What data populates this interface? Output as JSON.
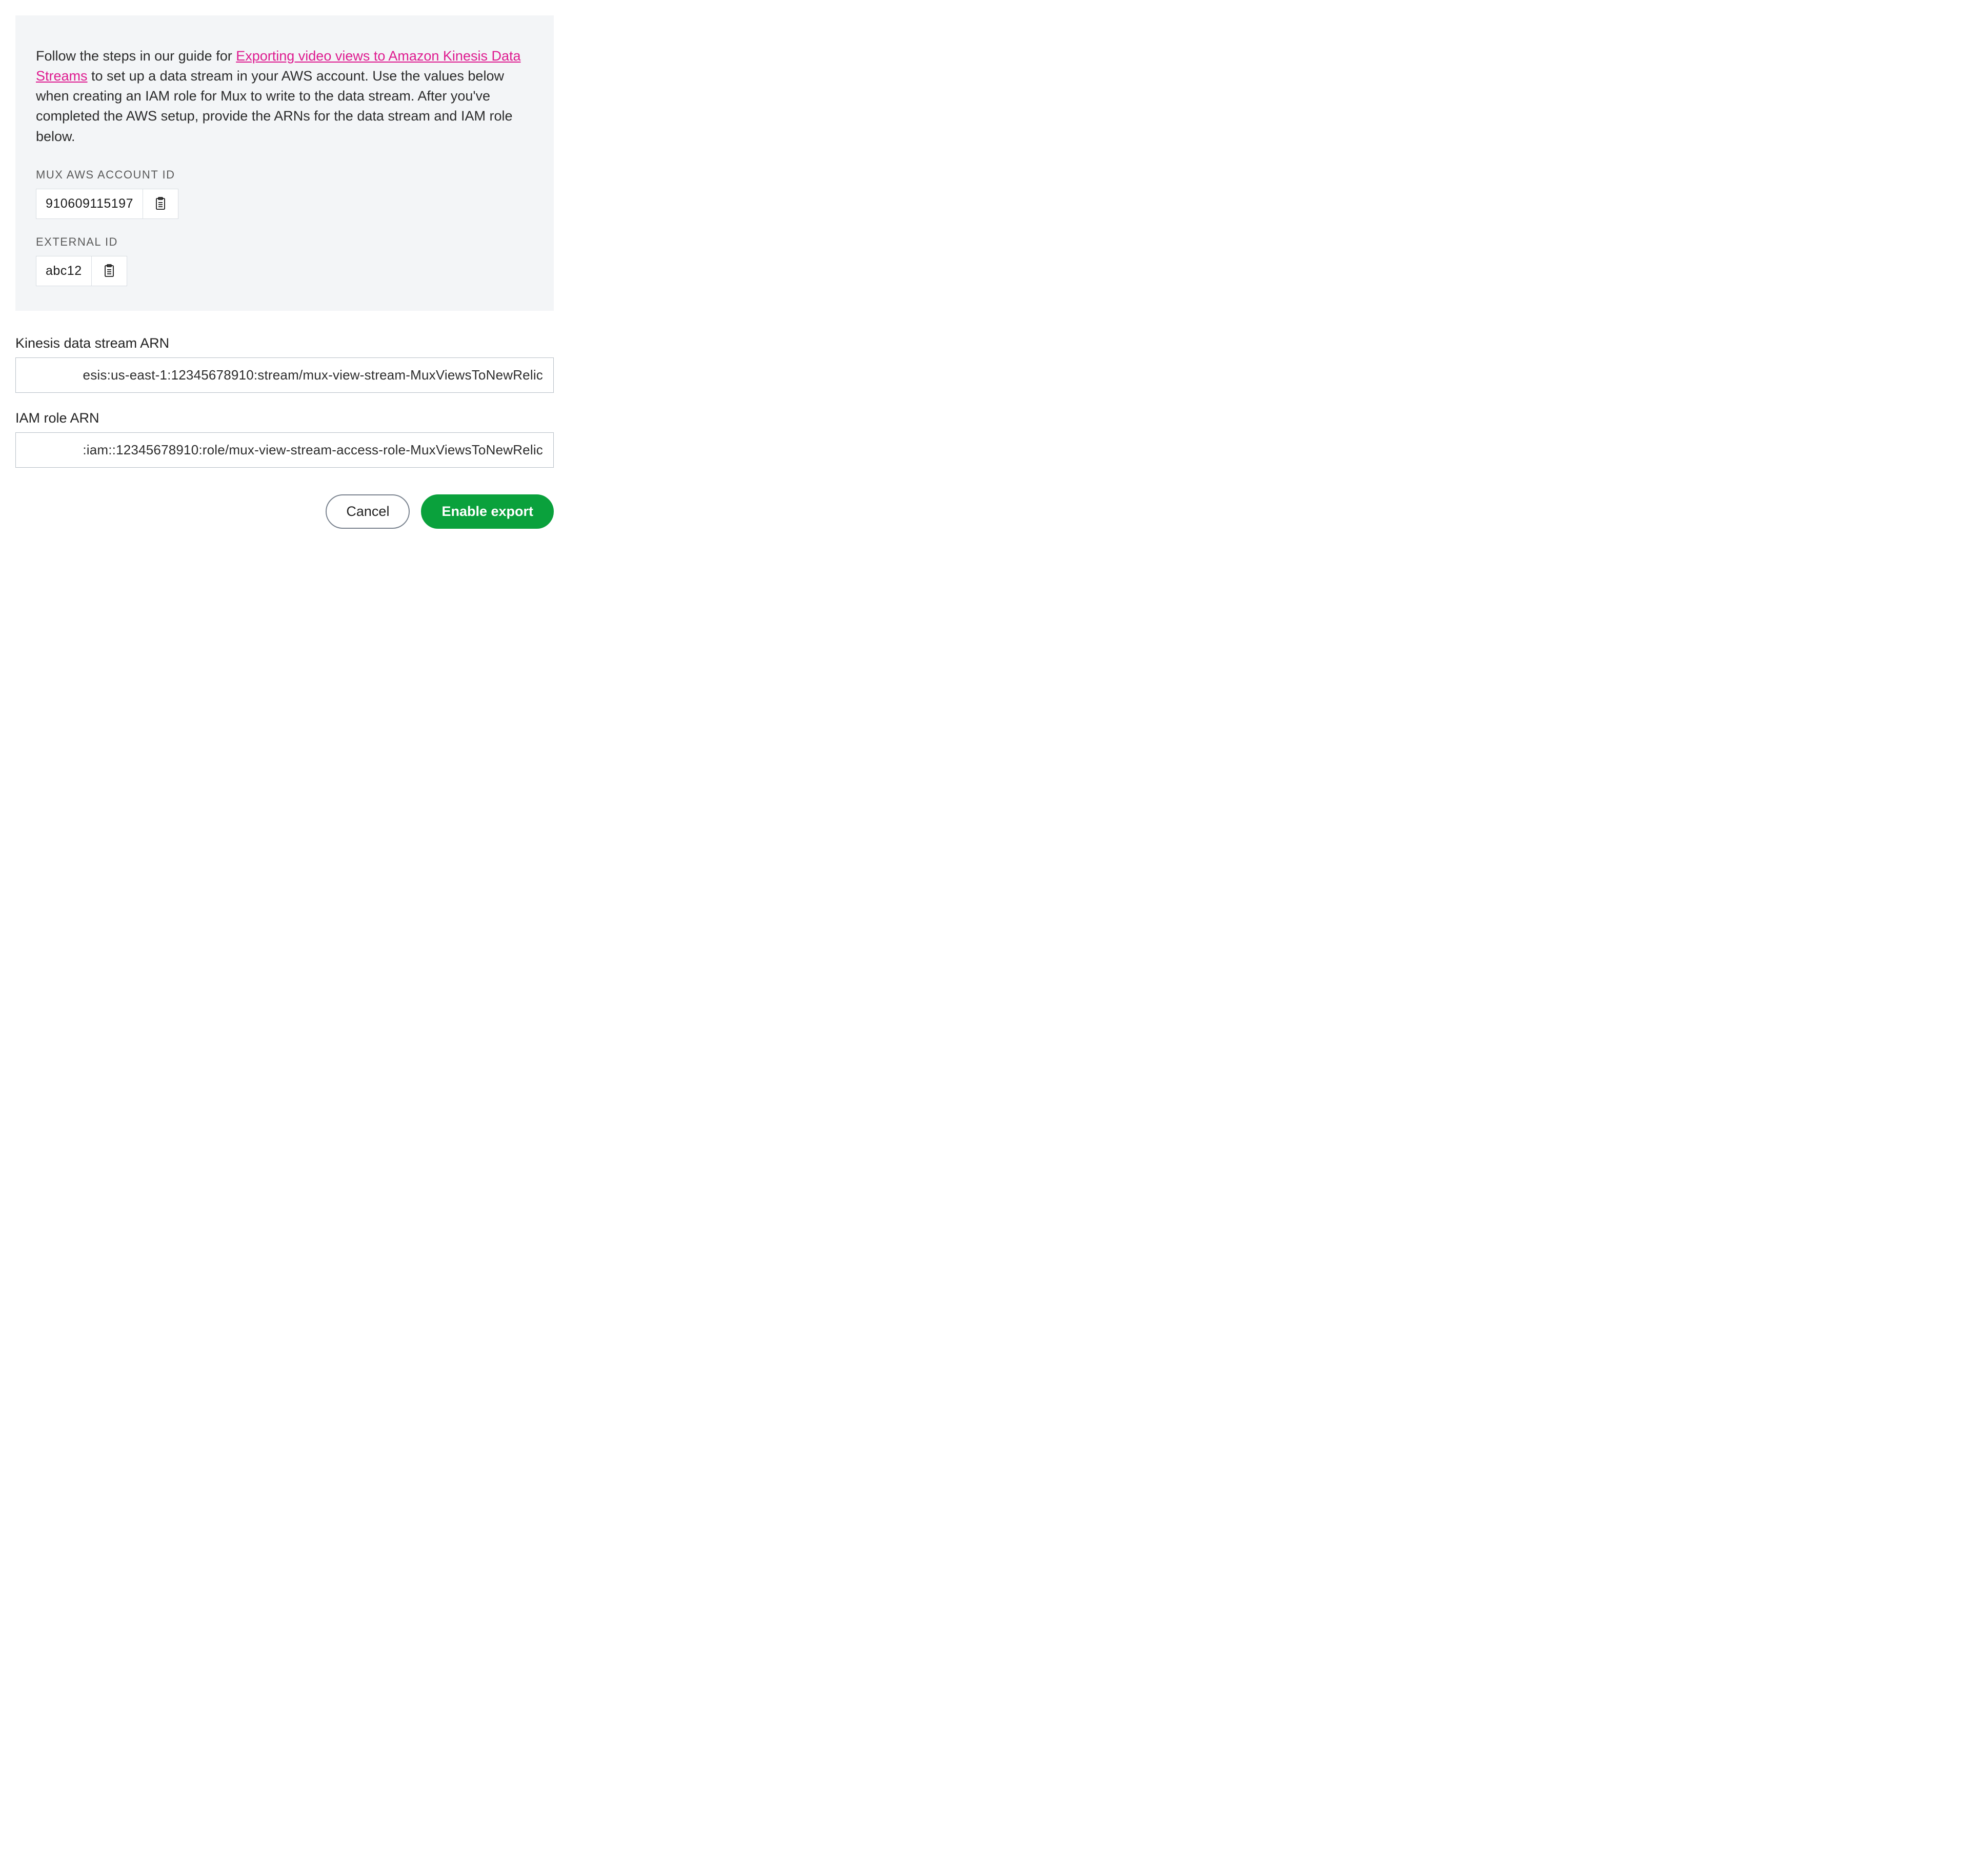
{
  "info": {
    "text_before": "Follow the steps in our guide for ",
    "link_text": "Exporting video views to Amazon Kinesis Data Streams",
    "text_after": " to set up a data stream in your AWS account. Use the values below when creating an IAM role for Mux to write to the data stream. After you've completed the AWS setup, provide the ARNs for the data stream and IAM role below."
  },
  "mux_account": {
    "label": "MUX AWS ACCOUNT ID",
    "value": "910609115197"
  },
  "external_id": {
    "label": "EXTERNAL ID",
    "value": "abc12"
  },
  "kinesis_arn": {
    "label": "Kinesis data stream ARN",
    "value": "esis:us-east-1:12345678910:stream/mux-view-stream-MuxViewsToNewRelic"
  },
  "iam_arn": {
    "label": "IAM role ARN",
    "value": ":iam::12345678910:role/mux-view-stream-access-role-MuxViewsToNewRelic"
  },
  "buttons": {
    "cancel": "Cancel",
    "enable": "Enable export"
  }
}
